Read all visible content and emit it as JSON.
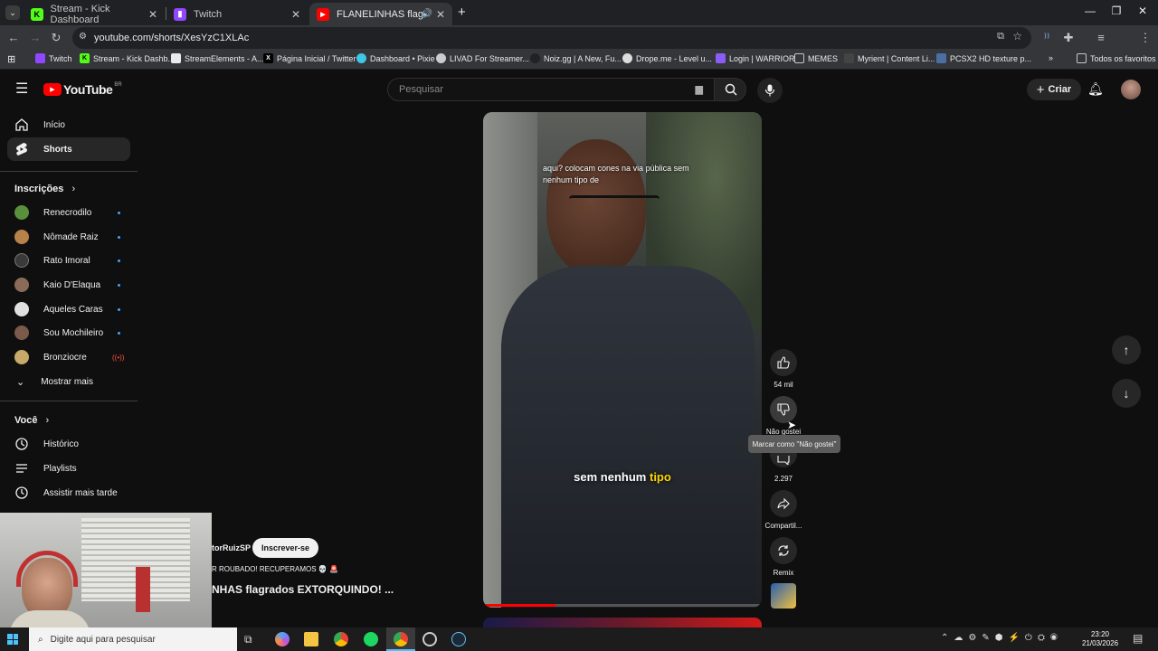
{
  "browser": {
    "tabs": [
      {
        "label": "Stream - Kick Dashboard",
        "icon": "kick-icon"
      },
      {
        "label": "Twitch",
        "icon": "twitch-icon"
      },
      {
        "label": "FLANELINHAS flagrados EX",
        "icon": "youtube-icon"
      }
    ],
    "url": "youtube.com/shorts/XesYzC1XLAc",
    "bookmarks": [
      "Twitch",
      "Stream - Kick Dashb...",
      "StreamElements - A...",
      "Página Inicial / Twitter",
      "Dashboard • Pixie",
      "LIVAD For Streamer...",
      "Noiz.gg | A New, Fu...",
      "Drope.me - Level u...",
      "Login | WARRIOR",
      "MEMES",
      "Myrient | Content Li...",
      "PCSX2 HD texture p...",
      "Todos os favoritos"
    ]
  },
  "youtube": {
    "logo": "YouTube",
    "region": "BR",
    "search_placeholder": "Pesquisar",
    "create_label": "Criar",
    "sidebar": {
      "main": [
        {
          "label": "Início",
          "icon": "home-icon"
        },
        {
          "label": "Shorts",
          "icon": "shorts-icon"
        }
      ],
      "subscriptions_title": "Inscrições",
      "channels": [
        {
          "name": "Renecrodilo",
          "color": "#5a8f3c"
        },
        {
          "name": "Nômade Raiz",
          "color": "#b7824a"
        },
        {
          "name": "Rato Imoral",
          "color": "#3a3a3a"
        },
        {
          "name": "Kaio D'Elaqua",
          "color": "#8a6b5a"
        },
        {
          "name": "Aqueles Caras",
          "color": "#e0e0e0"
        },
        {
          "name": "Sou Mochileiro",
          "color": "#7a5a4a"
        },
        {
          "name": "Bronziocre",
          "color": "#c9a96a"
        }
      ],
      "show_more": "Mostrar mais",
      "you_title": "Você",
      "you_items": [
        {
          "label": "Histórico",
          "icon": "history-icon"
        },
        {
          "label": "Playlists",
          "icon": "playlist-icon"
        },
        {
          "label": "Assistir mais tarde",
          "icon": "clock-icon"
        }
      ]
    },
    "short": {
      "top_caption": "aqui? colocam cones na via pública sem nenhum tipo de",
      "subtitle_white": "sem nenhum",
      "subtitle_yellow": "tipo",
      "channel_partial": "torRuizSP",
      "subscribe_label": "Inscrever-se",
      "description_partial": "R ROUBADO! RECUPERAMOS 💀 🚨",
      "title_partial": "NHAS flagrados EXTORQUINDO! ..."
    },
    "actions": {
      "likes": "54 mil",
      "dislike_label_partial": "Não gostei",
      "dislike_tooltip": "Marcar como \"Não gostei\"",
      "comments": "2.297",
      "share": "Compartil...",
      "remix": "Remix"
    }
  },
  "taskbar": {
    "search_placeholder": "Digite aqui para pesquisar",
    "time": "23:20",
    "date": "21/03/2026"
  }
}
